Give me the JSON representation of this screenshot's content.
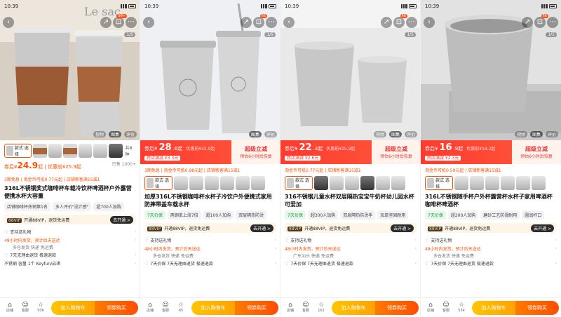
{
  "status_time": "10:39",
  "share_glyph": "↗",
  "panels": [
    {
      "cart_badge": "99+",
      "page_indicator": "1/5",
      "view_tabs": [
        "视频",
        "图集",
        "评价"
      ],
      "price_type": "plain",
      "style_label": "款式\n选择",
      "style_count": "共8种",
      "after_label": "券后¥",
      "after_price": "24.9",
      "after_suffix": "起 | 优惠前¥25.9起",
      "sold": "已售 1000+",
      "promo": "3期免息 | 淘金币可抵0.77元起 | 店铺新客满15减1",
      "title": "316L不锈钢奖式咖啡杯车载冷饮杯啤酒杯户外露营便携水杯大容量",
      "tags": [
        "店铺咖啡杯热销第1名",
        "多人评价\"设计感\"",
        "超700人加购"
      ],
      "tag_green": [
        false,
        false,
        false
      ],
      "vip": "开通88VIP，退货免运费",
      "vip_go": "去开通 >",
      "rows": [
        {
          "icon": "♡",
          "text": "支持送礼物",
          "orange": false
        },
        {
          "icon": "",
          "text": "48小时内发货，预计后天送达",
          "orange": true
        },
        {
          "icon": "",
          "text": "多仓发货  快递  免运费",
          "orange": false,
          "sub": true
        },
        {
          "icon": "♡",
          "text": "7天无理由退货  极速退款",
          "orange": false
        },
        {
          "icon": "",
          "text": "不锈钢  容量  1个  Keyfun/启琪",
          "orange": false
        }
      ],
      "bottom": {
        "store": "店铺",
        "service": "客服",
        "fav_count": "506",
        "cart_btn": "加入购物车",
        "buy_btn": "领券购买"
      }
    },
    {
      "cart_badge": "66",
      "page_indicator": "1/5",
      "view_tabs": [
        "图集",
        "评价"
      ],
      "price_type": "red",
      "red_prefix": "券后¥",
      "red_price": "28",
      "red_suffix": ".6起",
      "red_orig": "优惠前¥32.9起",
      "red_tag": "跨店满减 ¥3.3元",
      "red_right": "超级立减",
      "red_right_sub": "预估6小时后恢复",
      "promo": "3期免息 | 淘金币可抵0.98元起 | 店铺新客满15减1",
      "style_label": "款式\n选择",
      "style_count": "",
      "title": "加厚316L不锈钢咖啡杯水杯子冷饮户外便携式家用防摔带盖车载水杯",
      "tags": [
        "7天价保",
        "两钢单上涨7倍",
        "超100人加购",
        "双层隔热防烫"
      ],
      "tag_green": [
        true,
        false,
        false,
        false
      ],
      "vip": "开通88VIP，退货免运费",
      "vip_go": "去开通 >",
      "rows": [
        {
          "icon": "♡",
          "text": "支持送礼物",
          "orange": false
        },
        {
          "icon": "",
          "text": "48小时内发货，预计后天送达",
          "orange": true
        },
        {
          "icon": "",
          "text": "多仓发货  快递  免运费",
          "orange": false,
          "sub": true
        },
        {
          "icon": "♡",
          "text": "7天价保  7天无理由退货  极速退款",
          "orange": false
        }
      ],
      "bottom": {
        "store": "店铺",
        "service": "客服",
        "fav_count": "45",
        "cart_btn": "加入购物车",
        "buy_btn": "领券购买"
      }
    },
    {
      "cart_badge": "66",
      "page_indicator": "1/5",
      "view_tabs": [
        "视频",
        "图集",
        "评价"
      ],
      "price_type": "red",
      "red_prefix": "券后¥",
      "red_price": "22",
      "red_suffix": ".3起",
      "red_orig": "优惠前¥25.9起",
      "red_tag": "跨店满减 ¥2.6元",
      "red_right": "超级立减",
      "red_right_sub": "预估6小时后恢复",
      "promo": "淘金币可抵0.77元起 | 店铺新客满15减1",
      "style_label": "款式\n选择",
      "style_count": "",
      "title": "316不锈钢儿童水杯双层隔热宝宝牛奶杯幼儿园水杯可爱加",
      "tags": [
        "7天价保",
        "超300人加购",
        "双层隔热防烫手",
        "加厚坚固耐用"
      ],
      "tag_green": [
        true,
        false,
        false,
        false
      ],
      "vip": "开通88VIP，退货免运费",
      "vip_go": "去开通 >",
      "rows": [
        {
          "icon": "♡",
          "text": "支持送礼物",
          "orange": false
        },
        {
          "icon": "",
          "text": "48小时内发货，预计后天送达",
          "orange": true
        },
        {
          "icon": "",
          "text": "广东汕头  快递  免运费",
          "orange": false,
          "sub": true
        },
        {
          "icon": "♡",
          "text": "7天价保  7天无理由退货  极速退款",
          "orange": false
        }
      ],
      "bottom": {
        "store": "店铺",
        "service": "客服",
        "fav_count": "162",
        "cart_btn": "加入购物车",
        "buy_btn": "领券购买"
      }
    },
    {
      "cart_badge": "66",
      "page_indicator": "1/5",
      "view_tabs": [
        "视频",
        "图集",
        "评价"
      ],
      "price_type": "red",
      "red_prefix": "券后¥",
      "red_price": "16",
      "red_suffix": ".9起",
      "red_orig": "优惠前¥19.2起",
      "red_tag": "跨店满减 ¥2.3元",
      "red_right": "超级立减",
      "red_right_sub": "预估6小时后恢复",
      "promo": "淘金币可抵0.59元起 | 店铺新客满15减1",
      "style_label": "款式\n选择",
      "style_count": "",
      "title": "316L不锈钢随手杯户外杯露营杯水杯子家用啤酒杯咖啡杯啤酒杯",
      "tags": [
        "7天价保",
        "超200人加购",
        "磨砂工艺防滑耐用",
        "圆润杯口"
      ],
      "tag_green": [
        true,
        false,
        false,
        false
      ],
      "vip": "开通88VIP，退货免运费",
      "vip_go": "去开通 >",
      "rows": [
        {
          "icon": "♡",
          "text": "支持送礼物",
          "orange": false
        },
        {
          "icon": "",
          "text": "48小时内发货，预计后天送达",
          "orange": true
        },
        {
          "icon": "",
          "text": "多仓发货  快递  免运费",
          "orange": false,
          "sub": true
        },
        {
          "icon": "♡",
          "text": "7天价保  7天无理由退货  极速退款",
          "orange": false
        }
      ],
      "bottom": {
        "store": "店铺",
        "service": "客服",
        "fav_count": "534",
        "cart_btn": "加入购物车",
        "buy_btn": "领券购买"
      }
    }
  ],
  "colors": {
    "price_red": "#ff3b2f",
    "accent_orange": "#ff5000",
    "cart_yellow": "#ffc500",
    "buy_orange": "#ff4d00"
  }
}
